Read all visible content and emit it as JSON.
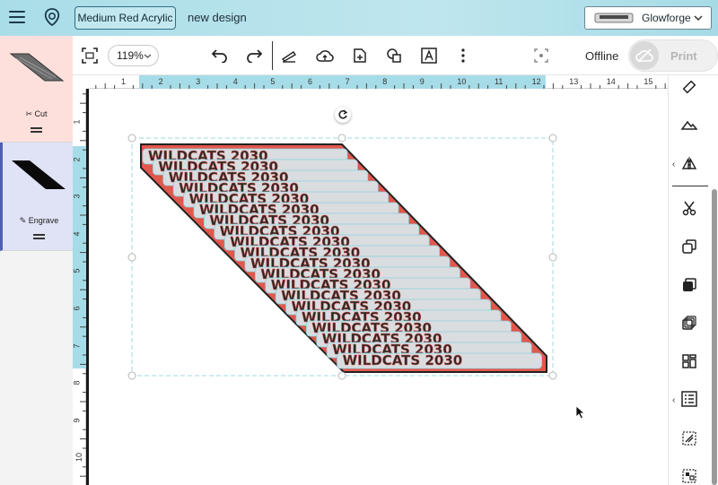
{
  "header": {
    "material": "Medium Red Acrylic",
    "design_name": "new design",
    "machine_name": "Glowforge",
    "icons": [
      "hamburger-menu-icon",
      "glowforge-logo-icon",
      "chevron-down-icon"
    ]
  },
  "steps": [
    {
      "label": "Cut",
      "icon": "scissors-icon"
    },
    {
      "label": "Engrave",
      "icon": "pencil-icon"
    }
  ],
  "toolbar": {
    "zoom": "119%",
    "offline": "Offline",
    "print": "Print",
    "icons": [
      "fit-to-view-icon",
      "undo-icon",
      "redo-icon",
      "scanner-icon",
      "upload-icon",
      "add-artwork-icon",
      "shapes-icon",
      "text-icon",
      "more-icon",
      "center-focus-icon",
      "offline-cloud-icon"
    ]
  },
  "ruler": {
    "top": [
      "1",
      "2",
      "3",
      "4",
      "5",
      "6",
      "7",
      "8",
      "9",
      "10",
      "11",
      "12",
      "13",
      "14",
      "15"
    ],
    "left": [
      "1",
      "2",
      "3",
      "4",
      "5",
      "6",
      "7",
      "8",
      "9",
      "10"
    ]
  },
  "design": {
    "text": "WILDCATS 2030",
    "colors": {
      "red": "#e2574c",
      "dark": "#2a2a2a",
      "selection": "#9fd8e3"
    }
  },
  "right_panel": {
    "icons": [
      "ruler-measure-icon",
      "mountain-icon",
      "flip-icon",
      "scissors-icon",
      "copy-icon",
      "duplicate-fill-icon",
      "stack-icon",
      "arrange-icon",
      "grid-icon",
      "pattern-icon",
      "group-icon"
    ]
  },
  "colors": {
    "header_bg": "#b7e3ec",
    "accent": "#a8dde8",
    "cut_bg": "#fde0dc",
    "engrave_bg": "#e0e3f6"
  }
}
